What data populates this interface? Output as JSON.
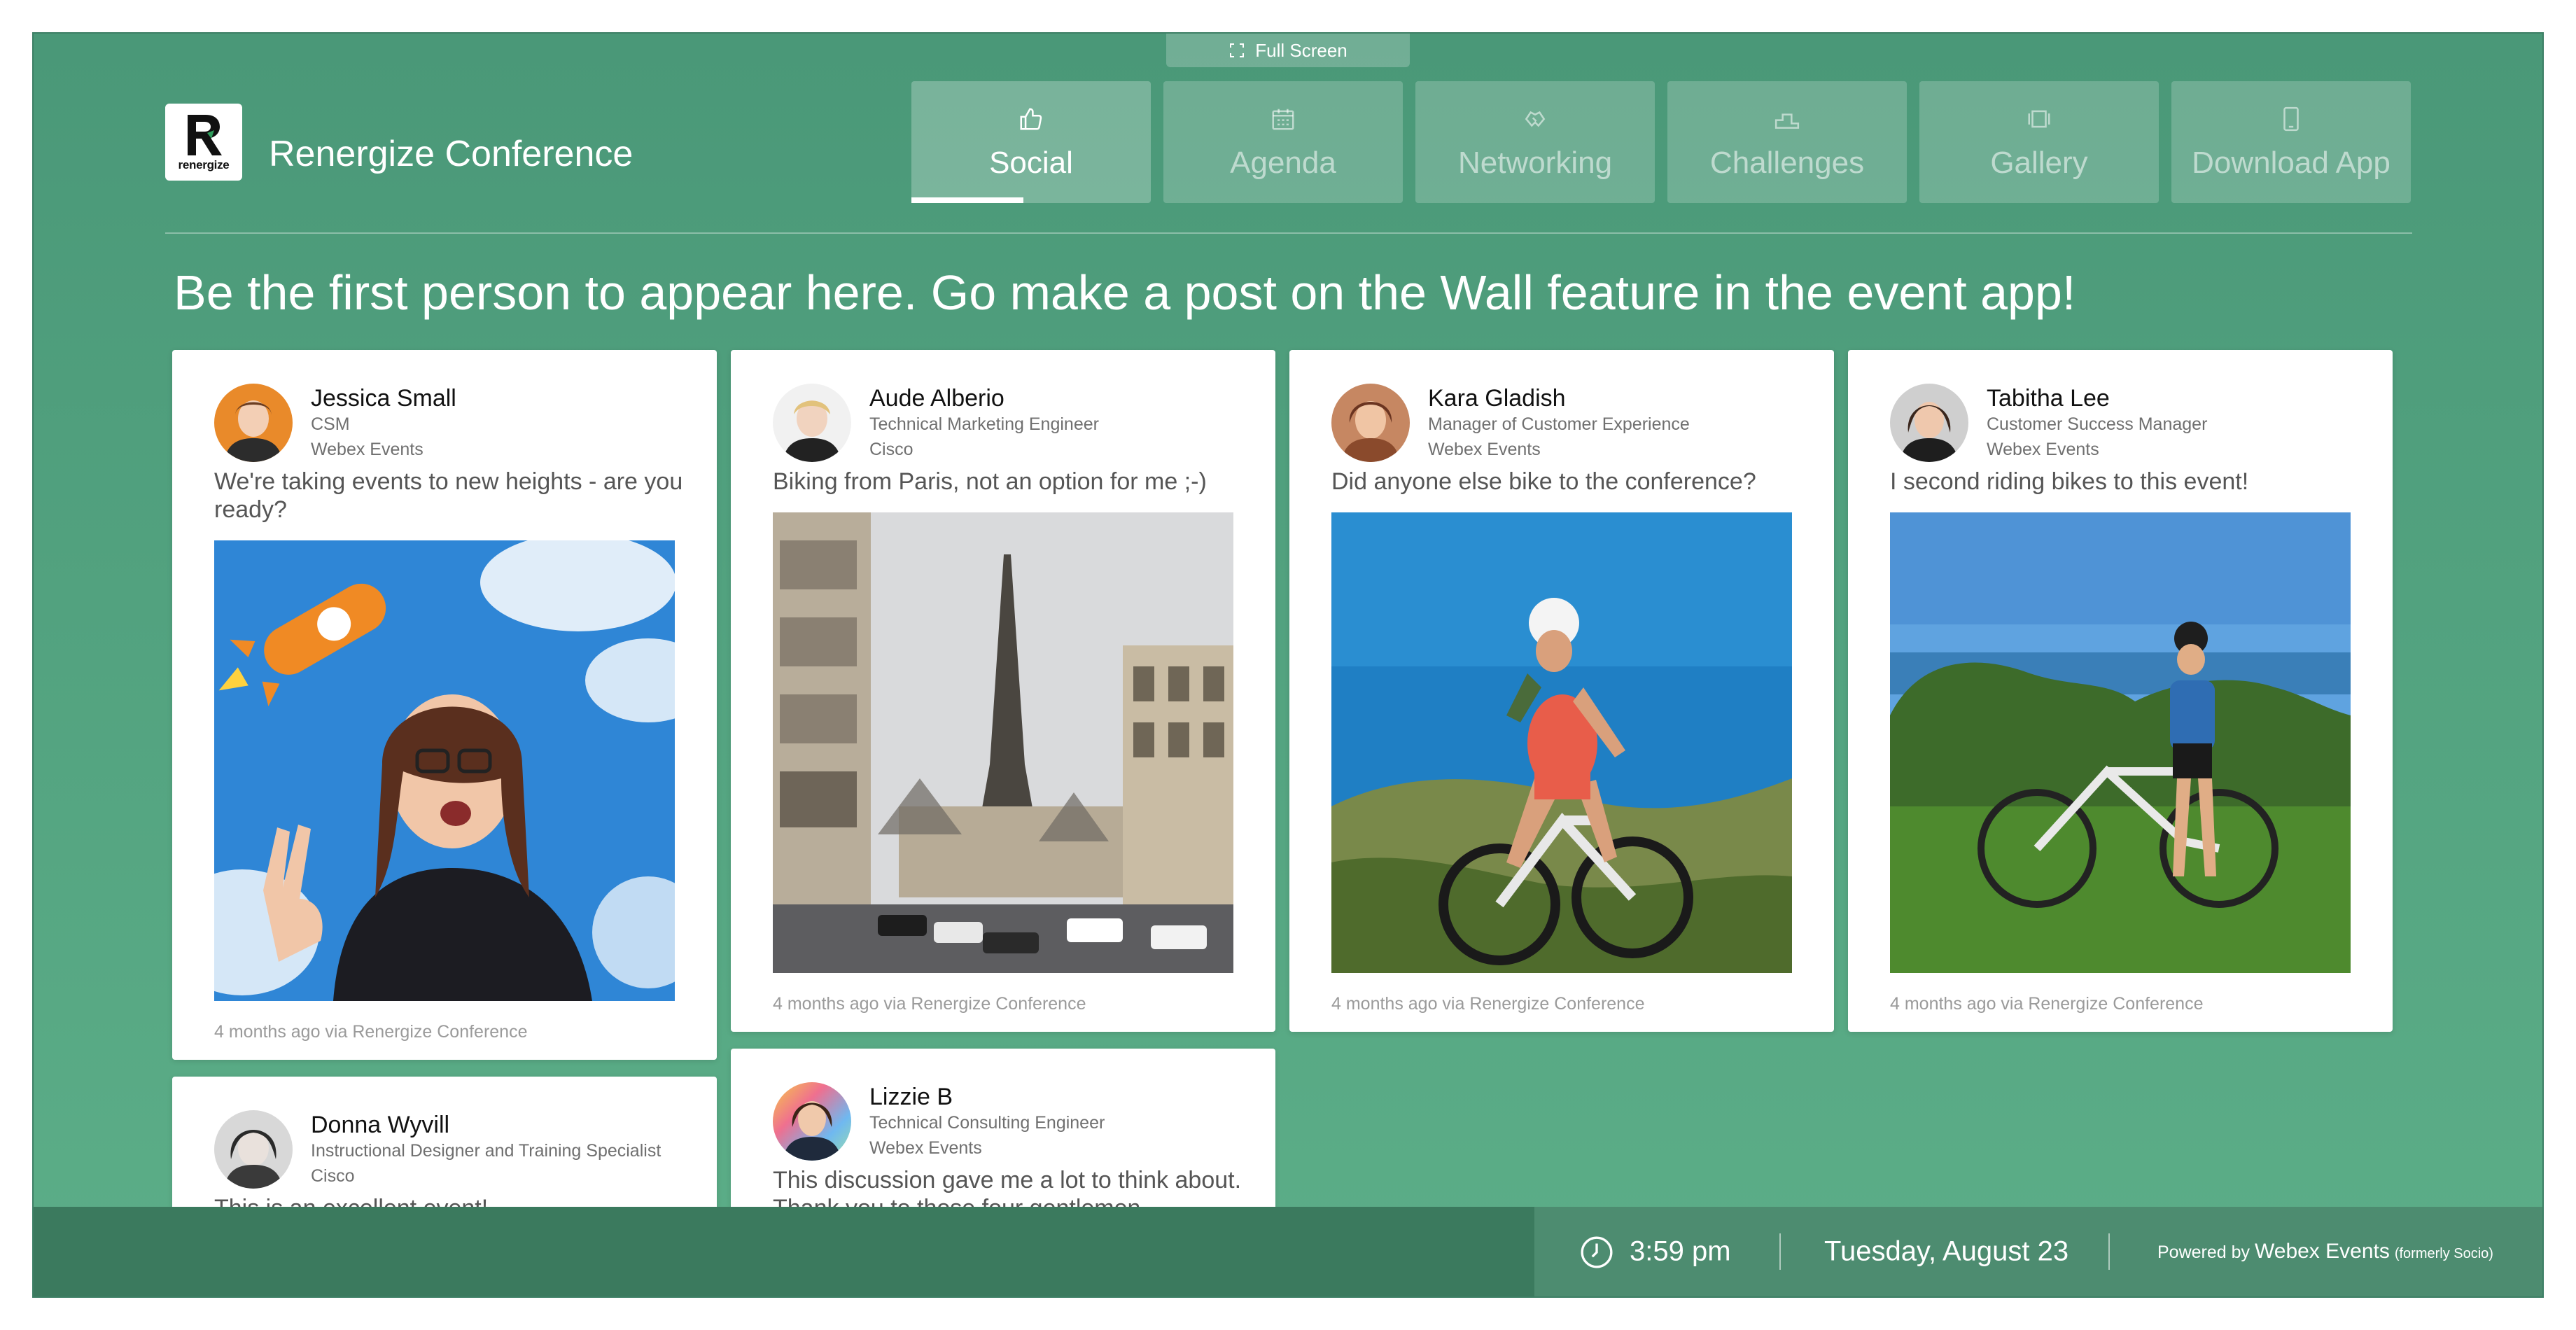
{
  "fullscreen": {
    "label": "Full Screen"
  },
  "header": {
    "logo_text": "renergize",
    "title": "Renergize Conference"
  },
  "tabs": [
    {
      "label": "Social",
      "icon": "thumbs-up-icon",
      "active": true
    },
    {
      "label": "Agenda",
      "icon": "calendar-icon",
      "active": false
    },
    {
      "label": "Networking",
      "icon": "handshake-icon",
      "active": false
    },
    {
      "label": "Challenges",
      "icon": "podium-icon",
      "active": false
    },
    {
      "label": "Gallery",
      "icon": "gallery-icon",
      "active": false
    },
    {
      "label": "Download App",
      "icon": "phone-icon",
      "active": false
    }
  ],
  "headline": "Be the first person to appear here. Go make a post on the Wall feature in the event app!",
  "posts": [
    {
      "name": "Jessica Small",
      "role": "CSM",
      "org": "Webex Events",
      "text": "We're taking events to new heights - are you ready?",
      "meta": "4 months ago via Renergize Conference"
    },
    {
      "name": "Aude Alberio",
      "role": "Technical Marketing Engineer",
      "org": "Cisco",
      "text": "Biking from Paris, not an option for me ;-)",
      "meta": "4 months ago via Renergize Conference"
    },
    {
      "name": "Kara Gladish",
      "role": "Manager of Customer Experience",
      "org": "Webex Events",
      "text": "Did anyone else bike to the conference?",
      "meta": "4 months ago via Renergize Conference"
    },
    {
      "name": "Tabitha Lee",
      "role": "Customer Success Manager",
      "org": "Webex Events",
      "text": "I second riding bikes to this event!",
      "meta": "4 months ago via Renergize Conference"
    },
    {
      "name": "Donna Wyvill",
      "role": "Instructional Designer and Training Specialist",
      "org": "Cisco",
      "text": "This is an excellent event!",
      "meta": ""
    },
    {
      "name": "Lizzie B",
      "role": "Technical Consulting Engineer",
      "org": "Webex Events",
      "text": "This discussion gave me a lot to think about. Thank you to those four gentlemen",
      "meta": ""
    }
  ],
  "status_bar": {
    "time": "3:59 pm",
    "date": "Tuesday, August 23",
    "powered_prefix": "Powered by",
    "powered_brand": "Webex Events",
    "powered_note": "(formerly Socio)"
  },
  "colors": {
    "background": "#52a27f",
    "bottom_bar": "#3b7a5e",
    "status_panel": "#4d8c70",
    "card": "#ffffff",
    "text_primary": "#111111",
    "text_secondary": "#6f6f6f"
  }
}
